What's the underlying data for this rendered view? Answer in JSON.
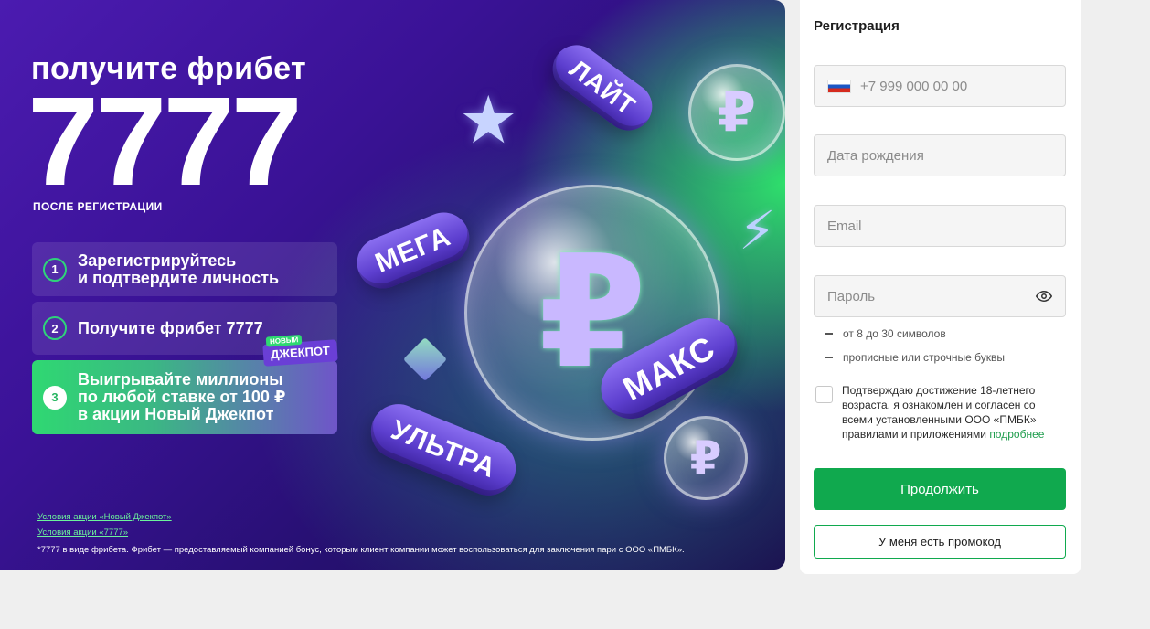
{
  "promo": {
    "headline": "получите фрибет",
    "amount": "7777",
    "after_registration": "ПОСЛЕ РЕГИСТРАЦИИ",
    "steps": [
      {
        "num": "1",
        "line1": "Зарегистрируйтесь",
        "line2": "и подтвердите личность"
      },
      {
        "num": "2",
        "line1": "Получите фрибет 7777"
      },
      {
        "num": "3",
        "line1": "Выигрывайте миллионы",
        "line2": "по любой ставке от 100 ₽",
        "line3": "в акции Новый Джекпот"
      }
    ],
    "jackpot_tag": {
      "new": "НОВЫЙ",
      "name": "ДЖЕКПОТ"
    },
    "pills": {
      "lite": "ЛАЙТ",
      "mega": "МЕГА",
      "max": "МАКС",
      "ultra": "УЛЬТРА"
    },
    "ruble_sign": "₽",
    "links": [
      "Условия акции «Новый Джекпот»",
      "Условия акции «7777»"
    ],
    "footnote": "*7777 в виде фрибета. Фрибет — предоставляемый компанией бонус, которым клиент компании может воспользоваться для заключения пари с ООО «ПМБК»."
  },
  "registration": {
    "title": "Регистрация",
    "phone_placeholder": "+7 999 000 00 00",
    "dob_placeholder": "Дата рождения",
    "email_placeholder": "Email",
    "password_placeholder": "Пароль",
    "hints": [
      "от 8 до 30 символов",
      "прописные или строчные буквы"
    ],
    "agree_text": "Подтверждаю достижение 18-летнего возраста, я ознакомлен и согласен со всеми установленными ООО «ПМБК» правилами и приложениями",
    "agree_link": "подробнее",
    "continue_label": "Продолжить",
    "promo_code_label": "У меня есть промокод"
  },
  "colors": {
    "accent_green": "#10a94e",
    "banner_purple": "#3a1296",
    "link_green": "#6cf39c"
  },
  "icons": {
    "phone_flag": "russia-flag-icon",
    "password_toggle": "eye-icon"
  }
}
